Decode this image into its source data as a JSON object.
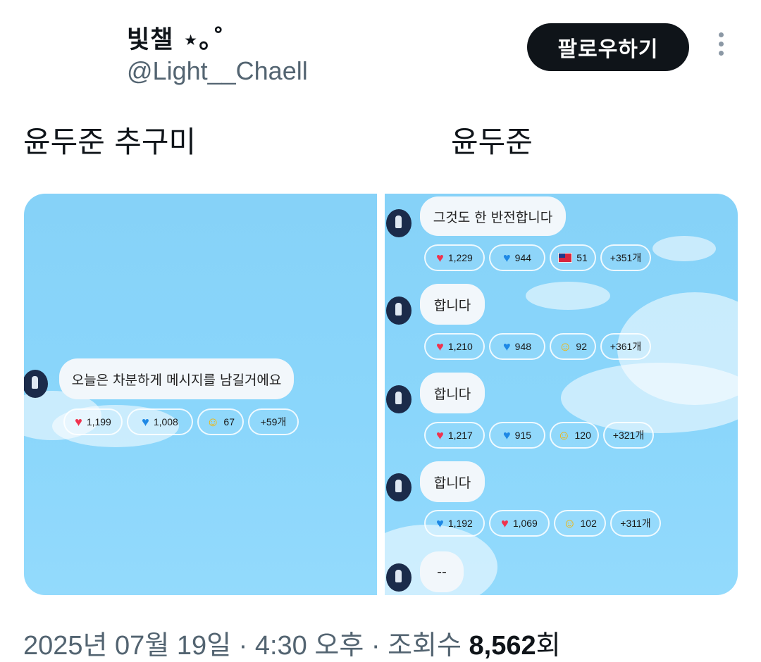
{
  "header": {
    "display_name": "빛챌 ⋆｡˚",
    "handle": "@Light__Chaell",
    "follow_label": "팔로우하기",
    "more_icon": "more-vertical-icon"
  },
  "post": {
    "left_text": "윤두준 추구미",
    "right_text": "윤두준"
  },
  "left_panel": {
    "message": "오늘은 차분하게 메시지를 남길거에요",
    "reactions": [
      {
        "icon": "heart-red-icon",
        "count": "1,199"
      },
      {
        "icon": "heart-blue-icon",
        "count": "1,008"
      },
      {
        "icon": "laugh-emoji-icon",
        "count": "67"
      },
      {
        "icon": "",
        "count": "+59개"
      }
    ]
  },
  "right_panel": {
    "messages": [
      {
        "text": "그것도 한 반전합니다",
        "reactions": [
          {
            "icon": "heart-red-icon",
            "count": "1,229"
          },
          {
            "icon": "heart-blue-icon",
            "count": "944"
          },
          {
            "icon": "flag-taiwan-icon",
            "count": "51"
          },
          {
            "icon": "",
            "count": "+351개"
          }
        ]
      },
      {
        "text": "합니다",
        "reactions": [
          {
            "icon": "heart-red-icon",
            "count": "1,210"
          },
          {
            "icon": "heart-blue-icon",
            "count": "948"
          },
          {
            "icon": "laugh-emoji-icon",
            "count": "92"
          },
          {
            "icon": "",
            "count": "+361개"
          }
        ]
      },
      {
        "text": "합니다",
        "reactions": [
          {
            "icon": "heart-red-icon",
            "count": "1,217"
          },
          {
            "icon": "heart-blue-icon",
            "count": "915"
          },
          {
            "icon": "laugh-emoji-icon",
            "count": "120"
          },
          {
            "icon": "",
            "count": "+321개"
          }
        ]
      },
      {
        "text": "합니다",
        "reactions": [
          {
            "icon": "heart-blue-icon",
            "count": "1,192"
          },
          {
            "icon": "heart-red-icon",
            "count": "1,069"
          },
          {
            "icon": "laugh-emoji-icon",
            "count": "102"
          },
          {
            "icon": "",
            "count": "+311개"
          }
        ]
      },
      {
        "text": "--",
        "reactions": []
      }
    ]
  },
  "footer": {
    "date": "2025년 07월 19일",
    "separator": "·",
    "time": "4:30 오후",
    "views_label": "조회수",
    "views_count": "8,562",
    "views_unit": "회"
  }
}
